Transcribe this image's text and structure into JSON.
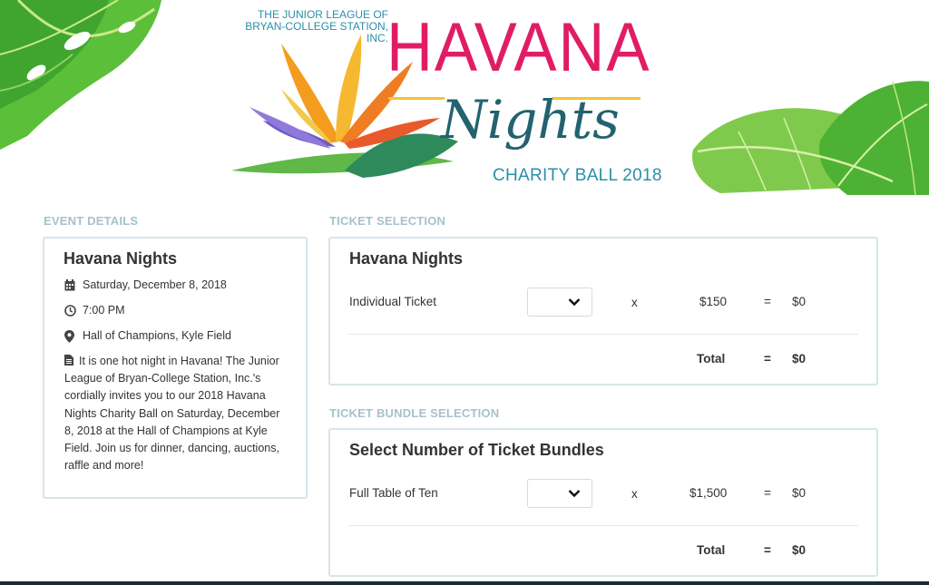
{
  "banner": {
    "org_line1": "THE JUNIOR LEAGUE OF",
    "org_line2": "BRYAN-COLLEGE STATION, INC.",
    "title": "HAVANA",
    "script_title": "Nights",
    "subtitle": "CHARITY BALL 2018",
    "colors": {
      "title": "#e01d64",
      "script": "#22636f",
      "accent": "#2a8fa8",
      "gold": "#f4c432"
    }
  },
  "event_details": {
    "section_label": "EVENT DETAILS",
    "name": "Havana Nights",
    "date": "Saturday, December 8, 2018",
    "time": "7:00 PM",
    "location": "Hall of Champions, Kyle Field",
    "description": "It is one hot night in Havana! The Junior League of Bryan-College Station, Inc.'s cordially invites you to our 2018 Havana Nights Charity Ball on Saturday, December 8, 2018 at the Hall of Champions at Kyle Field. Join us for dinner, dancing, auctions, raffle and more!",
    "icons": [
      "calendar-icon",
      "clock-icon",
      "map-marker-icon",
      "document-icon"
    ]
  },
  "ticket_selection": {
    "section_label": "TICKET SELECTION",
    "title": "Havana Nights",
    "item": {
      "name": "Individual Ticket",
      "qty": "",
      "times": "x",
      "price": "$150",
      "equals": "=",
      "subtotal": "$0"
    },
    "total": {
      "label": "Total",
      "equals": "=",
      "value": "$0"
    }
  },
  "bundle_selection": {
    "section_label": "TICKET BUNDLE SELECTION",
    "title": "Select Number of Ticket Bundles",
    "item": {
      "name": "Full Table of Ten",
      "qty": "",
      "times": "x",
      "price": "$1,500",
      "equals": "=",
      "subtotal": "$0"
    },
    "total": {
      "label": "Total",
      "equals": "=",
      "value": "$0"
    }
  }
}
